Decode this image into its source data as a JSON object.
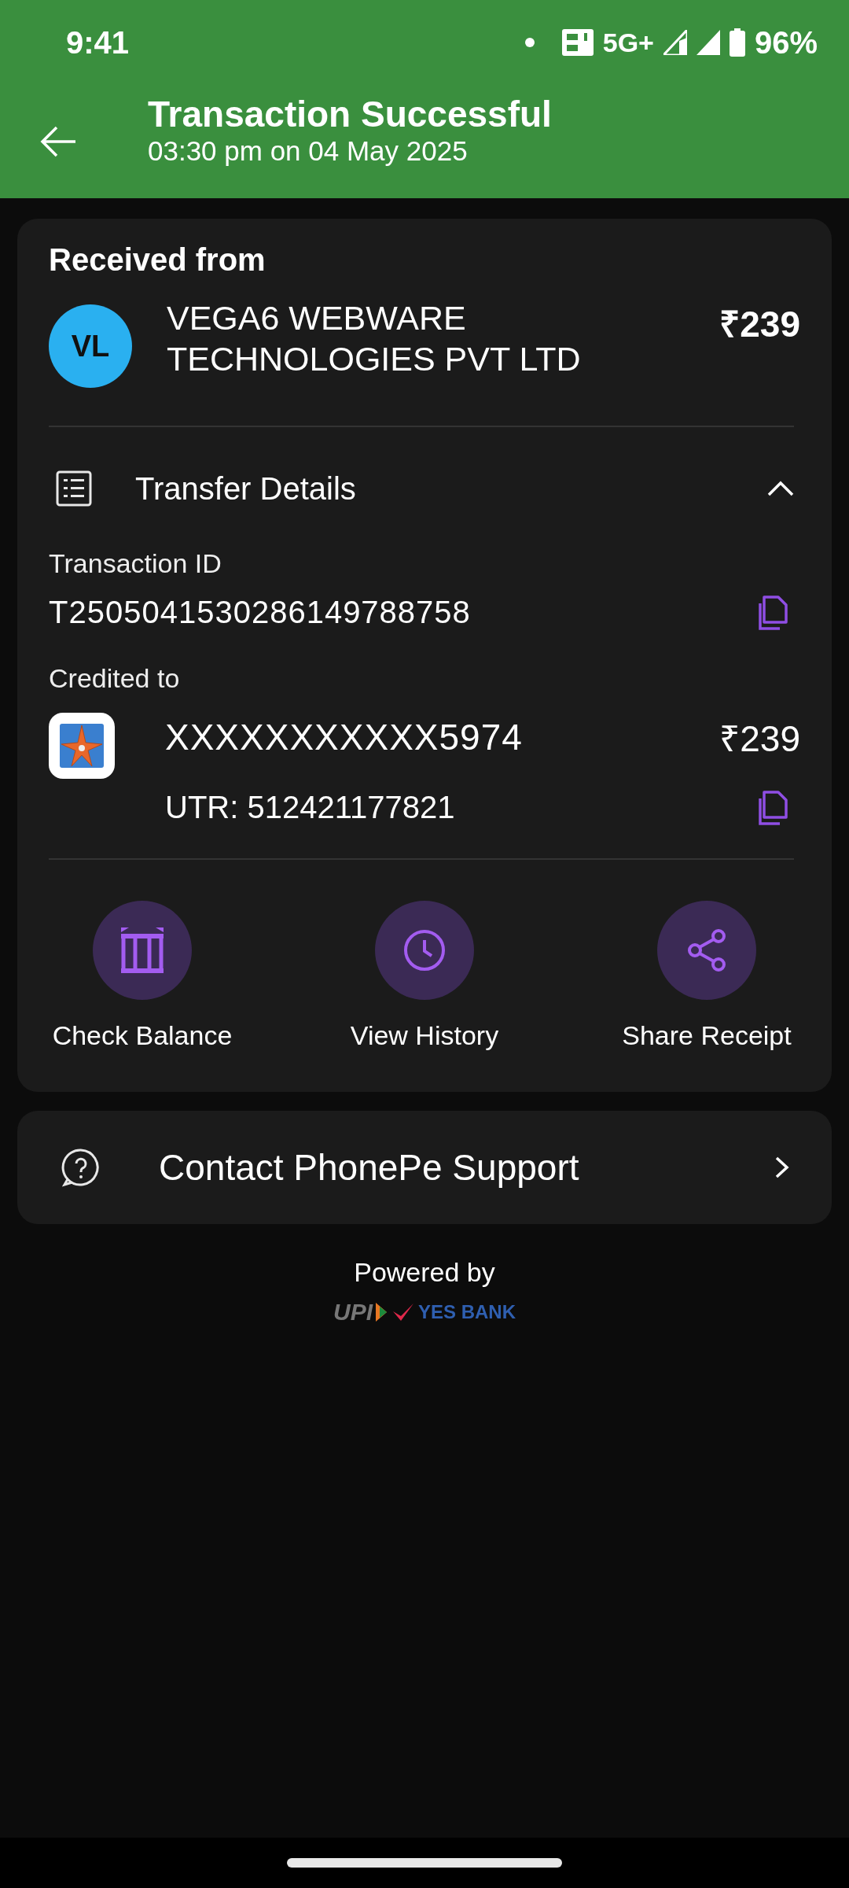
{
  "status_bar": {
    "time": "9:41",
    "network": "5G+",
    "battery": "96%"
  },
  "header": {
    "title": "Transaction Successful",
    "subtitle": "03:30 pm on 04 May 2025"
  },
  "payer": {
    "heading": "Received from",
    "initials": "VL",
    "name": "VEGA6 WEBWARE TECHNOLOGIES PVT LTD",
    "amount": "₹239"
  },
  "transfer_details": {
    "title": "Transfer Details",
    "expanded": true,
    "transaction_id_label": "Transaction ID",
    "transaction_id": "T2505041530286149788758",
    "credited_label": "Credited to",
    "account": "XXXXXXXXXXX5974",
    "account_amount": "₹239",
    "utr": "UTR: 512421177821"
  },
  "actions": [
    {
      "kind": "bank",
      "label": "Check Balance"
    },
    {
      "kind": "history",
      "label": "View History"
    },
    {
      "kind": "share",
      "label": "Share Receipt"
    }
  ],
  "support": {
    "label": "Contact PhonePe Support"
  },
  "footer": {
    "powered_by": "Powered by",
    "upi": "UPI",
    "bank": "YES BANK"
  }
}
